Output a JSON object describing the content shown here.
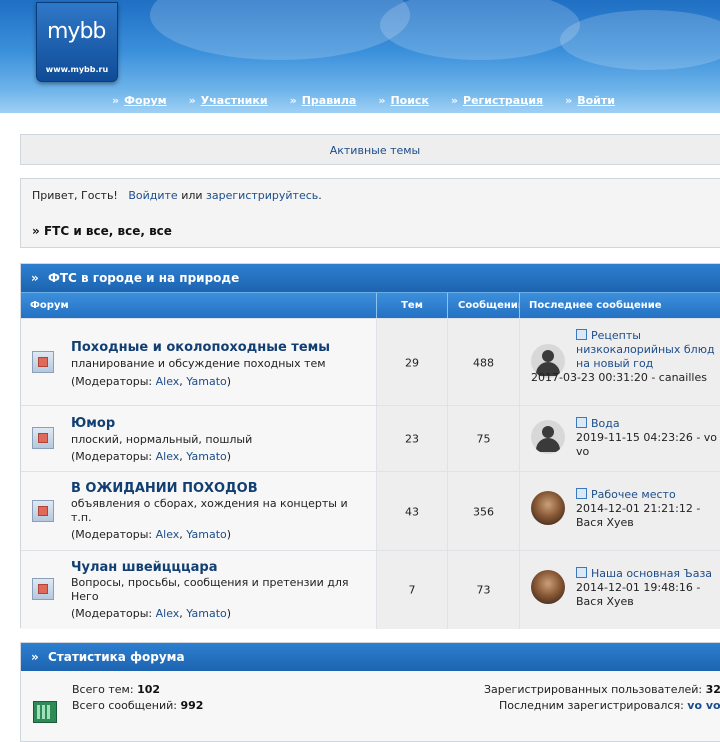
{
  "header": {
    "logo_mark": "mybb",
    "logo_url": "www.mybb.ru",
    "nav": [
      {
        "label": "Форум"
      },
      {
        "label": "Участники"
      },
      {
        "label": "Правила"
      },
      {
        "label": "Поиск"
      },
      {
        "label": "Регистрация"
      },
      {
        "label": "Войти"
      }
    ]
  },
  "active_topics": "Активные темы",
  "welcome": {
    "greeting": "Привет, Гость!",
    "login": "Войдите",
    "or": "или",
    "register": "зарегистрируйтесь",
    "period": ".",
    "crumb_prefix": "»",
    "crumb": "FTC и все, все, все"
  },
  "category": {
    "title": "ФТС в городе и на природе",
    "columns": {
      "forum": "Форум",
      "topics": "Тем",
      "messages": "Сообщений",
      "last": "Последнее сообщение"
    },
    "mods_label": "(Модераторы:",
    "mod1": "Alex",
    "sep": ",",
    "mod2": "Yamato",
    "close": ")",
    "forums": [
      {
        "title": "Походные и околопоходные темы",
        "desc": "планирование и обсуждение походных тем",
        "topics": "29",
        "messages": "488",
        "last_title": "Рецепты низкокалорийных блюд на новый год",
        "last_meta": "2017-03-23 00:31:20 - canailles",
        "avatar": "default-avatar"
      },
      {
        "title": "Юмор",
        "desc": "плоский, нормальный, пошлый",
        "topics": "23",
        "messages": "75",
        "last_title": "Вода",
        "last_meta": "2019-11-15 04:23:26 - vo vo",
        "avatar": "default-avatar"
      },
      {
        "title": "В ОЖИДАНИИ ПОХОДОВ",
        "desc": "объявления о сборах, хождения на концерты и т.п.",
        "topics": "43",
        "messages": "356",
        "last_title": "Рабочее место",
        "last_meta": "2014-12-01 21:21:12 - Вася Хуев",
        "avatar": "photo-avatar"
      },
      {
        "title": "Чулан швейцццара",
        "desc": "Вопросы, просьбы, сообщения и претензии для Него",
        "topics": "7",
        "messages": "73",
        "last_title": "Наша основная Ъаза",
        "last_meta": "2014-12-01 19:48:16 - Вася Хуев",
        "avatar": "photo-avatar"
      }
    ]
  },
  "stats": {
    "title": "Статистика форума",
    "topics_label": "Всего тем:",
    "topics_value": "102",
    "messages_label": "Всего сообщений:",
    "messages_value": "992",
    "users_label": "Зарегистрированных пользователей:",
    "users_value": "32",
    "last_reg_label": "Последним зарегистрировался:",
    "last_reg_value": "vo vo"
  }
}
